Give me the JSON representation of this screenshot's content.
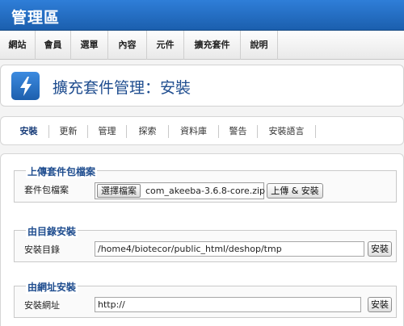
{
  "app": {
    "title": "管理區"
  },
  "menu": {
    "items": [
      {
        "label": "網站"
      },
      {
        "label": "會員"
      },
      {
        "label": "選單"
      },
      {
        "label": "內容"
      },
      {
        "label": "元件"
      },
      {
        "label": "擴充套件"
      },
      {
        "label": "說明"
      }
    ]
  },
  "header": {
    "title": "擴充套件管理：安裝",
    "icon": "lightning-icon",
    "accent": "#2a6fcc"
  },
  "tabs": {
    "items": [
      {
        "label": "安裝"
      },
      {
        "label": "更新"
      },
      {
        "label": "管理"
      },
      {
        "label": "探索"
      },
      {
        "label": "資料庫"
      },
      {
        "label": "警告"
      },
      {
        "label": "安裝語言"
      }
    ]
  },
  "upload": {
    "legend": "上傳套件包檔案",
    "label": "套件包檔案",
    "choose_label": "選擇檔案",
    "file_name": "com_akeeba-3.6.8-core.zip",
    "submit_label": "上傳 & 安裝"
  },
  "directory": {
    "legend": "由目錄安裝",
    "label": "安裝目錄",
    "value": "/home4/biotecor/public_html/deshop/tmp",
    "submit_label": "安裝"
  },
  "url": {
    "legend": "由網址安裝",
    "label": "安裝網址",
    "value": "http://",
    "submit_label": "安裝"
  }
}
